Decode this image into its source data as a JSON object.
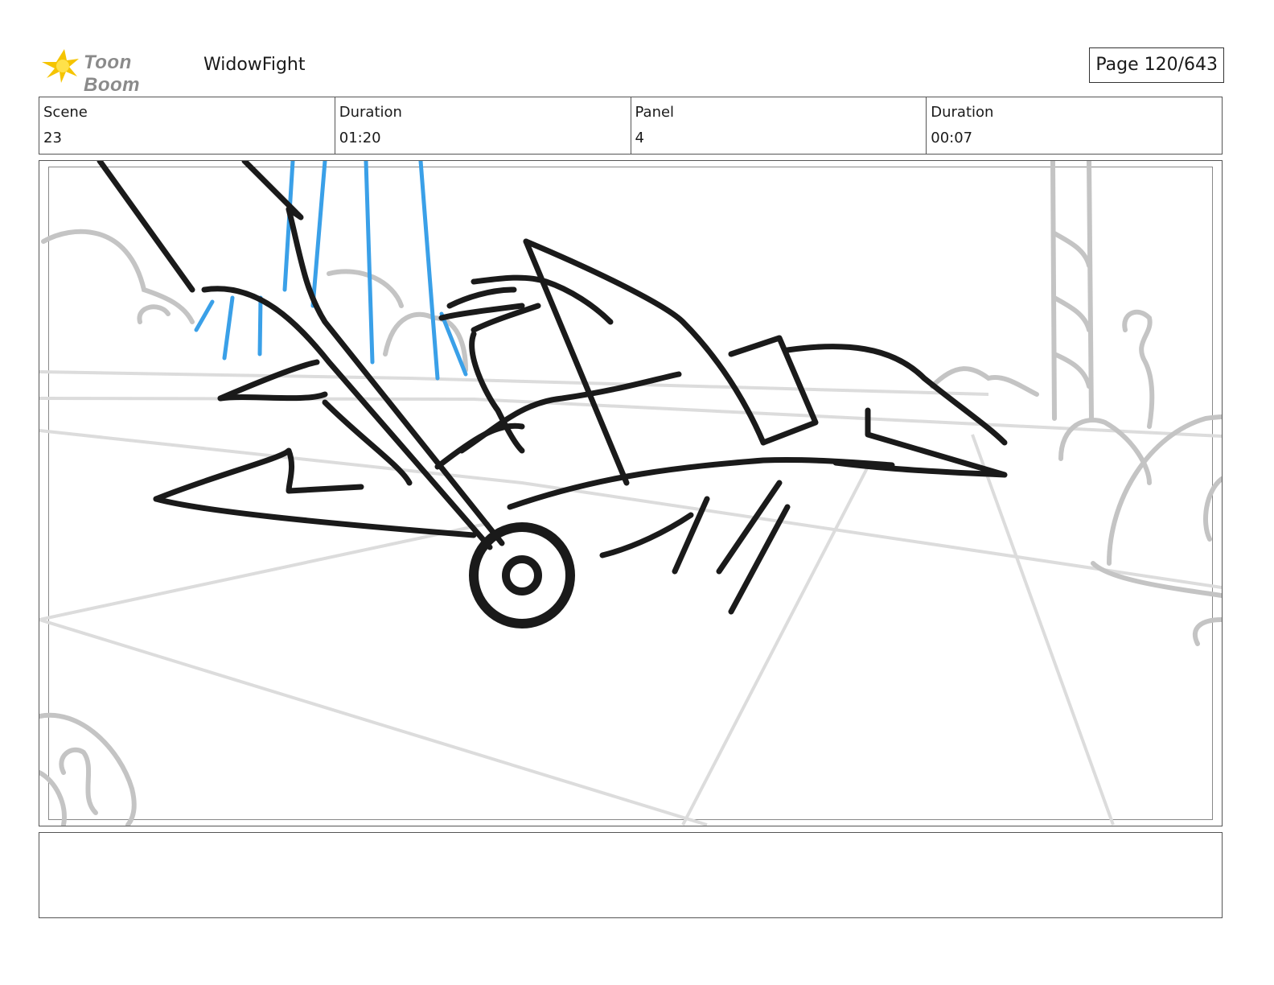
{
  "header": {
    "logo_text": "Toon Boom",
    "project_title": "WidowFight",
    "page_label": "Page 120/643"
  },
  "info": [
    {
      "label": "Scene",
      "value": "23"
    },
    {
      "label": "Duration",
      "value": "01:20"
    },
    {
      "label": "Panel",
      "value": "4"
    },
    {
      "label": "Duration",
      "value": "00:07"
    }
  ],
  "panel": {
    "sketch_colors": {
      "ink": "#1a1a1a",
      "background": "#c4c4c4",
      "floor": "#dcdcdc",
      "action": "#3aa0e8"
    }
  },
  "notes": {
    "text": ""
  },
  "colors": {
    "logo_star": "#f5c400",
    "border": "#555555"
  }
}
